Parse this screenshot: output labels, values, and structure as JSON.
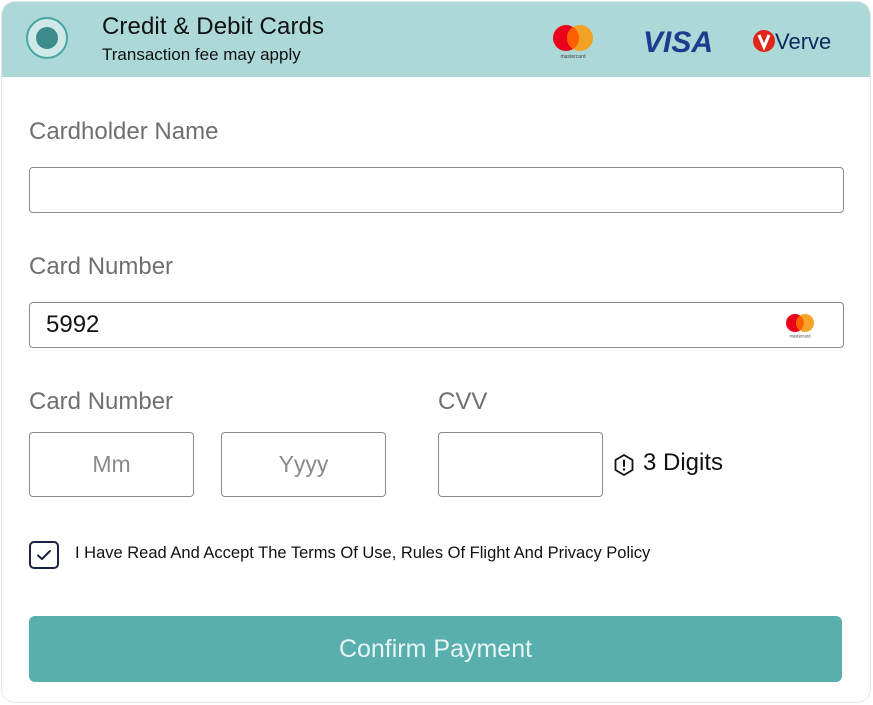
{
  "header": {
    "title": "Credit & Debit Cards",
    "subtitle": "Transaction fee may apply",
    "logos": {
      "mastercard_text": "mastercard",
      "visa_text": "VISA",
      "verve_text": "Verve"
    }
  },
  "form": {
    "name_label": "Cardholder Name",
    "name_value": "",
    "card_number_label": "Card Number",
    "card_number_value": "5992",
    "card_input_logo_text": "mastercard",
    "expiry_label": "Card Number",
    "mm_placeholder": "Mm",
    "yyyy_placeholder": "Yyyy",
    "cvv_label": "CVV",
    "cvv_value": "",
    "cvv_hint": "3 Digits",
    "terms_text": "I Have Read And Accept The Terms Of Use, Rules Of Flight And Privacy Policy",
    "terms_checked": true
  },
  "actions": {
    "confirm_label": "Confirm Payment"
  },
  "colors": {
    "header_bg": "#acd8d8",
    "button_bg": "#59aeae",
    "radio_ring": "#4aa5a5",
    "visa_blue": "#1a3d8f",
    "verve_red": "#e0261b",
    "verve_text": "#0b2a5e"
  }
}
